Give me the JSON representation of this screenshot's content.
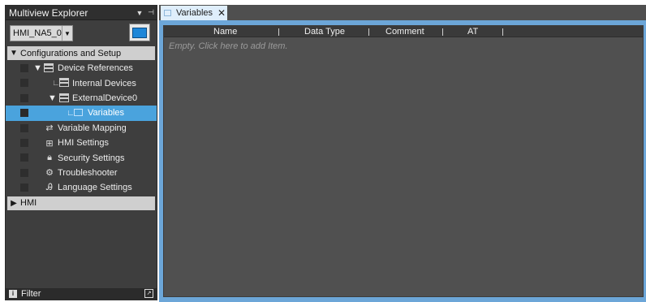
{
  "explorer": {
    "title": "Multiview Explorer",
    "pin_glyph": "▾ ⊣",
    "device_select": {
      "value": "HMI_NA5_0"
    },
    "sections": [
      {
        "label": "Configurations and Setup",
        "expanded": true
      },
      {
        "label": "HMI",
        "expanded": false
      }
    ],
    "tree": [
      {
        "label": "Device References",
        "icon": "device-references-icon"
      },
      {
        "label": "Internal Devices",
        "icon": "internal-devices-icon"
      },
      {
        "label": "ExternalDevice0",
        "icon": "external-device-icon"
      },
      {
        "label": "Variables",
        "icon": "variables-icon",
        "selected": true
      },
      {
        "label": "Variable Mapping",
        "icon": "variable-mapping-icon"
      },
      {
        "label": "HMI Settings",
        "icon": "hmi-settings-icon"
      },
      {
        "label": "Security Settings",
        "icon": "security-settings-icon"
      },
      {
        "label": "Troubleshooter",
        "icon": "troubleshooter-icon"
      },
      {
        "label": "Language Settings",
        "icon": "language-settings-icon"
      }
    ],
    "filter_label": "Filter"
  },
  "editor": {
    "tab": {
      "label": "Variables",
      "close": "✕"
    },
    "columns": [
      "Name",
      "Data Type",
      "Comment",
      "AT"
    ],
    "empty_message": "Empty. Click here to add Item."
  },
  "colors": {
    "panel_bg": "#3e3e3e",
    "selection": "#4aa3dd",
    "editor_frame": "#6ca6d8",
    "grid_bg": "#505050"
  }
}
